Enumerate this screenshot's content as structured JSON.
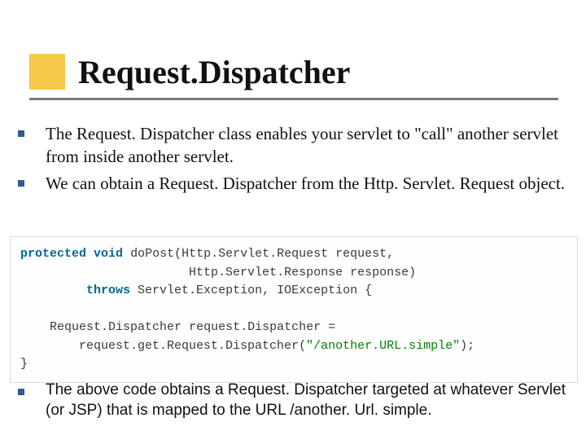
{
  "title": "Request.Dispatcher",
  "bullets_top": [
    "The Request. Dispatcher class enables your servlet to \"call\" another servlet from inside another servlet.",
    "We can obtain a Request. Dispatcher from the Http. Servlet. Request object."
  ],
  "code": {
    "kw_protected": "protected",
    "kw_void": "void",
    "fn": "doPost",
    "p1_type": "Http.Servlet.Request",
    "p1_name": "request",
    "p2_type": "Http.Servlet.Response",
    "p2_name": "response",
    "kw_throws": "throws",
    "ex1": "Servlet.Exception",
    "ex2": "IOException",
    "decl_type": "Request.Dispatcher",
    "decl_name": "request.Dispatcher",
    "call": "request.get.Request.Dispatcher",
    "str_arg": "\"/another.URL.simple\""
  },
  "bullets_bottom": [
    "The above code obtains a Request. Dispatcher targeted at whatever Servlet (or JSP) that is mapped to the URL /another. Url. simple."
  ]
}
